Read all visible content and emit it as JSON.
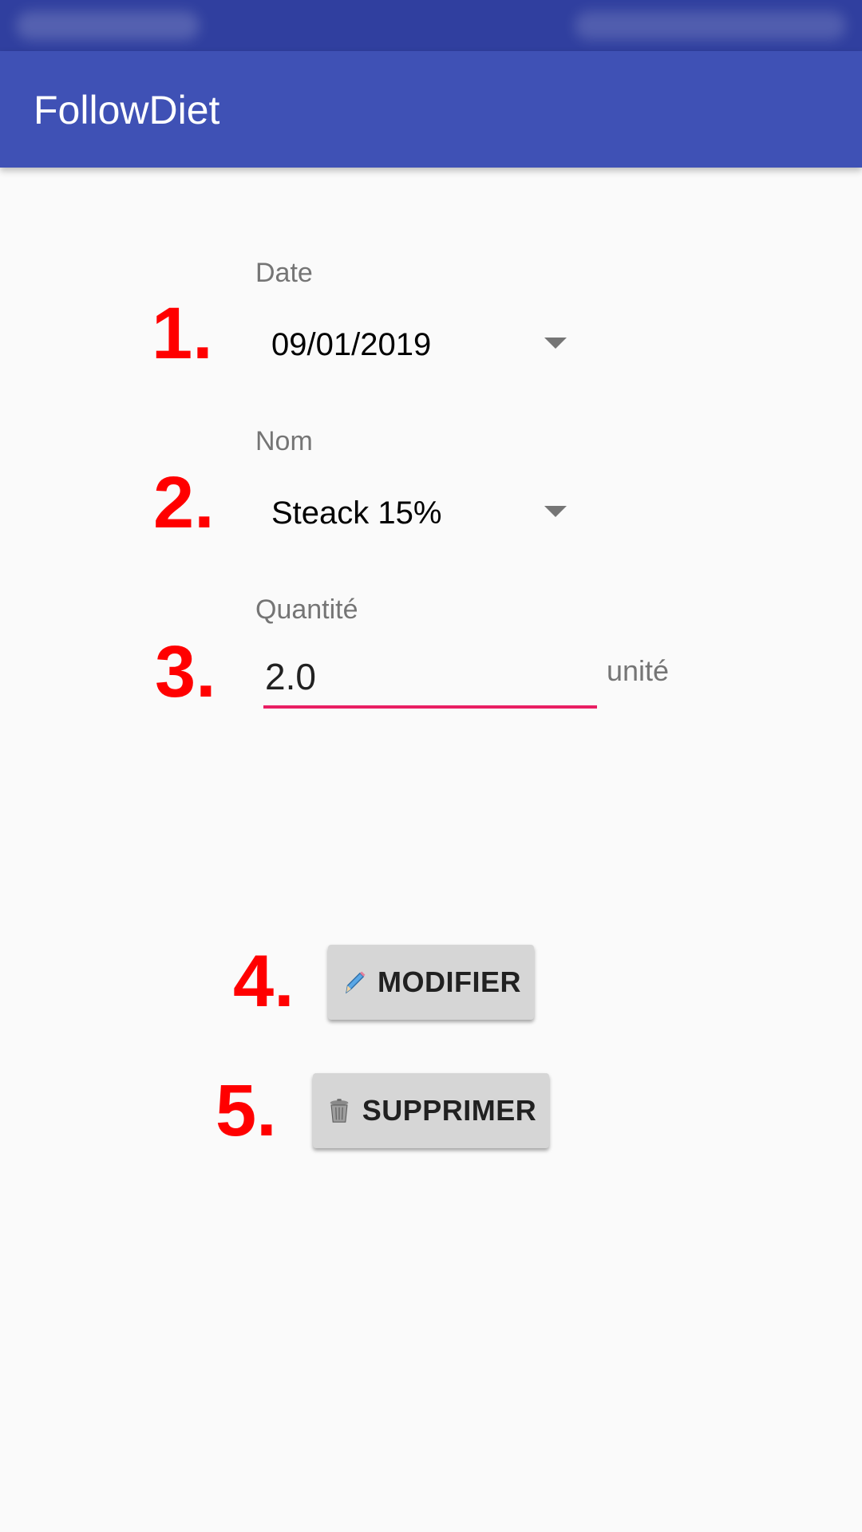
{
  "app": {
    "title": "FollowDiet"
  },
  "steps": [
    "1.",
    "2.",
    "3.",
    "4.",
    "5."
  ],
  "form": {
    "date": {
      "label": "Date",
      "value": "09/01/2019"
    },
    "name": {
      "label": "Nom",
      "value": "Steack 15%"
    },
    "quantity": {
      "label": "Quantité",
      "value": "2.0",
      "unit": "unité"
    }
  },
  "actions": {
    "modify_label": "MODIFIER",
    "delete_label": "SUPPRIMER",
    "modify_icon": "pencil-icon",
    "delete_icon": "trash-icon"
  },
  "colors": {
    "status_bar": "#303f9f",
    "app_bar": "#3f51b5",
    "accent": "#e91e63",
    "annotation": "#ff0000",
    "button": "#d6d6d6"
  }
}
